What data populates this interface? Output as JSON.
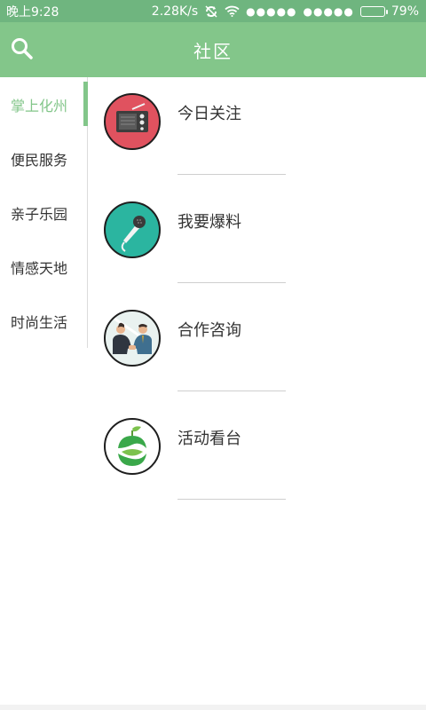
{
  "status_bar": {
    "time": "晚上9:28",
    "speed": "2.28K/s",
    "signal1": "●●●●●",
    "signal2": "●●●●●",
    "battery_percent": "79%",
    "battery_level": 0.79
  },
  "app_bar": {
    "title": "社区",
    "search_icon": "search-icon"
  },
  "sidebar": {
    "items": [
      {
        "label": "掌上化州",
        "active": true
      },
      {
        "label": "便民服务",
        "active": false
      },
      {
        "label": "亲子乐园",
        "active": false
      },
      {
        "label": "情感天地",
        "active": false
      },
      {
        "label": "时尚生活",
        "active": false
      }
    ]
  },
  "content": {
    "items": [
      {
        "label": "今日关注",
        "icon": "radio-icon",
        "color": "#e0525f"
      },
      {
        "label": "我要爆料",
        "icon": "microphone-icon",
        "color": "#2bb5a0"
      },
      {
        "label": "合作咨询",
        "icon": "handshake-icon",
        "color": "#e9f2f0"
      },
      {
        "label": "活动看台",
        "icon": "leaf-logo-icon",
        "color": "#ffffff"
      }
    ]
  },
  "colors": {
    "status_bar": "#6fb57f",
    "accent": "#83c68a"
  }
}
